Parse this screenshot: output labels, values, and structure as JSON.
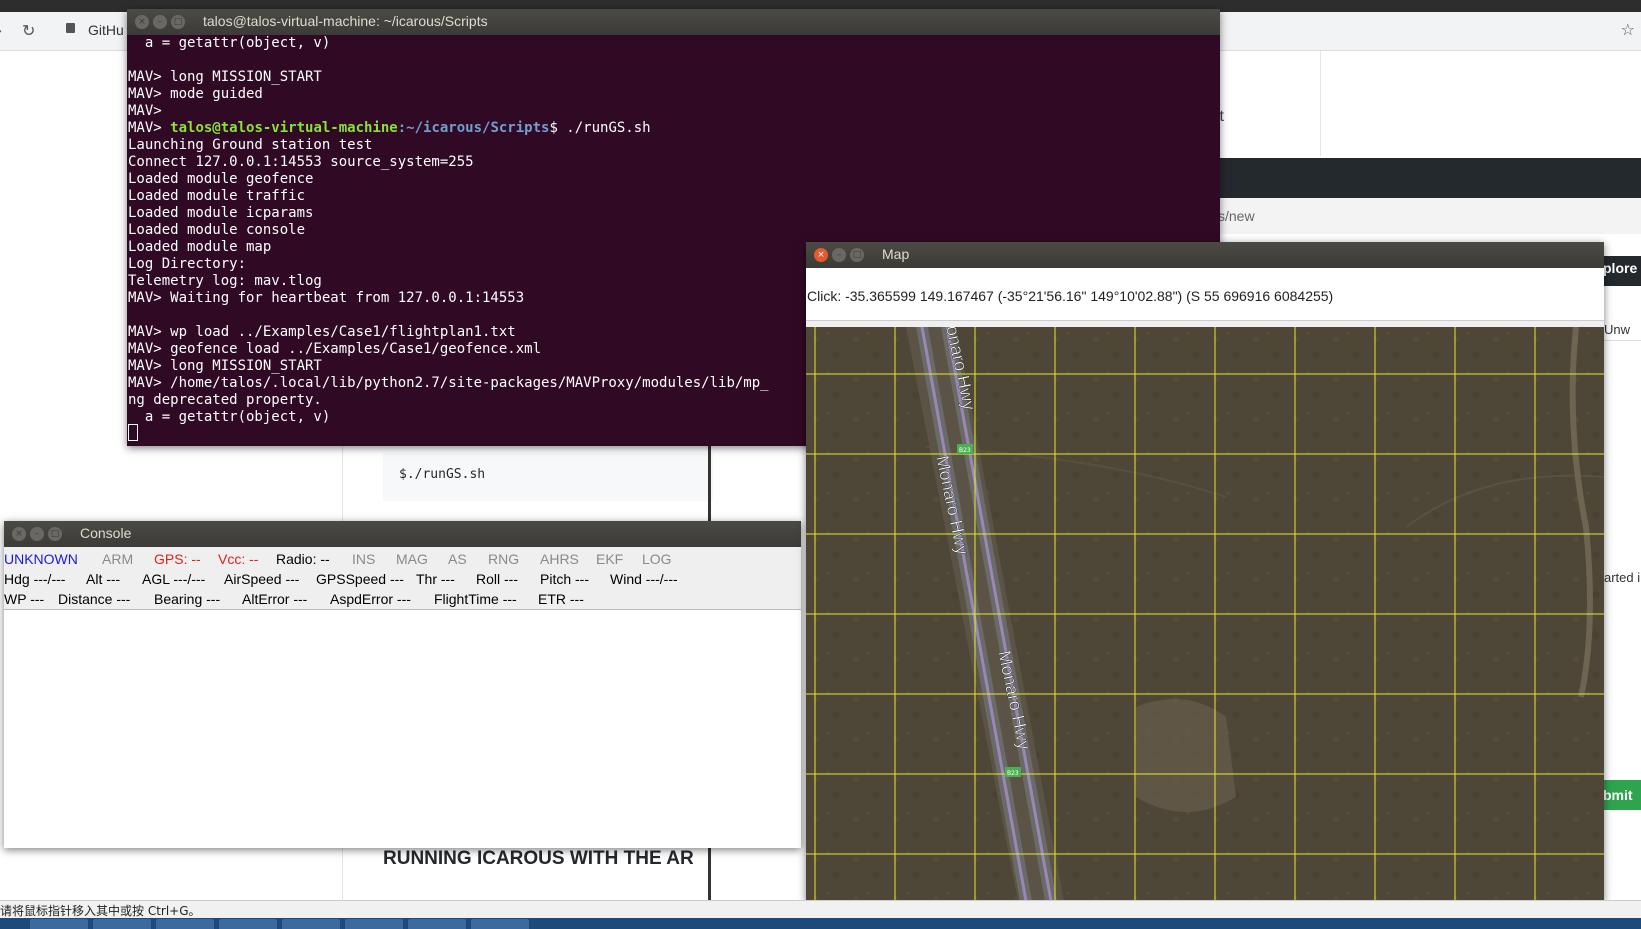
{
  "browser": {
    "address_prefix": "GitHu",
    "page_text_lt": "lt",
    "page_url_fragment": "s/new",
    "explore_label": "plore",
    "unwatch_label": "Unw",
    "started_label": "arted i",
    "submit_label": "bmit n",
    "code_snippet": "$./runGS.sh",
    "section_heading": "RUNNING ICAROUS WITH THE AR"
  },
  "terminal": {
    "title": "talos@talos-virtual-machine: ~/icarous/Scripts",
    "lines": [
      "  a = getattr(object, v)",
      "",
      "MAV> long MISSION_START",
      "MAV> mode guided",
      "MAV> ",
      "",
      "Launching Ground station test",
      "Connect 127.0.0.1:14553 source_system=255",
      "Loaded module geofence",
      "Loaded module traffic",
      "Loaded module icparams",
      "Loaded module console",
      "Loaded module map",
      "Log Directory: ",
      "Telemetry log: mav.tlog",
      "MAV> Waiting for heartbeat from 127.0.0.1:14553",
      "",
      "MAV> wp load ../Examples/Case1/flightplan1.txt",
      "MAV> geofence load ../Examples/Case1/geofence.xml",
      "MAV> long MISSION_START",
      "MAV> /home/talos/.local/lib/python2.7/site-packages/MAVProxy/modules/lib/mp_",
      "ng deprecated property.",
      "  a = getattr(object, v)"
    ],
    "prompt_prefix": "MAV> ",
    "prompt_user": "talos@talos-virtual-machine",
    "prompt_path": ":~/icarous/Scripts",
    "prompt_command": "$ ./runGS.sh"
  },
  "console": {
    "title": "Console",
    "row1": [
      {
        "text": "UNKNOWN",
        "color": "#1a1adb"
      },
      {
        "text": "ARM",
        "color": "#8a8a8a"
      },
      {
        "text": "GPS: --",
        "color": "#e0201b"
      },
      {
        "text": "Vcc: --",
        "color": "#e0201b"
      },
      {
        "text": "Radio: --",
        "color": "#000000"
      },
      {
        "text": "INS",
        "color": "#8a8a8a"
      },
      {
        "text": "MAG",
        "color": "#8a8a8a"
      },
      {
        "text": "AS",
        "color": "#8a8a8a"
      },
      {
        "text": "RNG",
        "color": "#8a8a8a"
      },
      {
        "text": "AHRS",
        "color": "#8a8a8a"
      },
      {
        "text": "EKF",
        "color": "#8a8a8a"
      },
      {
        "text": "LOG",
        "color": "#8a8a8a"
      }
    ],
    "row2": [
      "Hdg ---/---",
      "Alt ---",
      "AGL ---/---",
      "AirSpeed ---",
      "GPSSpeed ---",
      "Thr ---",
      "Roll ---",
      "Pitch ---",
      "Wind ---/---"
    ],
    "row3": [
      "WP ---",
      "Distance ---",
      "Bearing ---",
      "AltError ---",
      "AspdError ---",
      "FlightTime ---",
      "ETR ---"
    ]
  },
  "map": {
    "title": "Map",
    "click_text": "Click: -35.365599 149.167467 (-35°21'56.16\" 149°10'02.88\") (S 55 696916 6084255)",
    "road_label": "Monaro Hwy",
    "road_label_top": "onaro Hwy",
    "route_badge": "B23",
    "grid_color": "#e8e82a"
  },
  "statusbar": {
    "text": "请将鼠标指针移入其中或按 Ctrl+G。"
  }
}
